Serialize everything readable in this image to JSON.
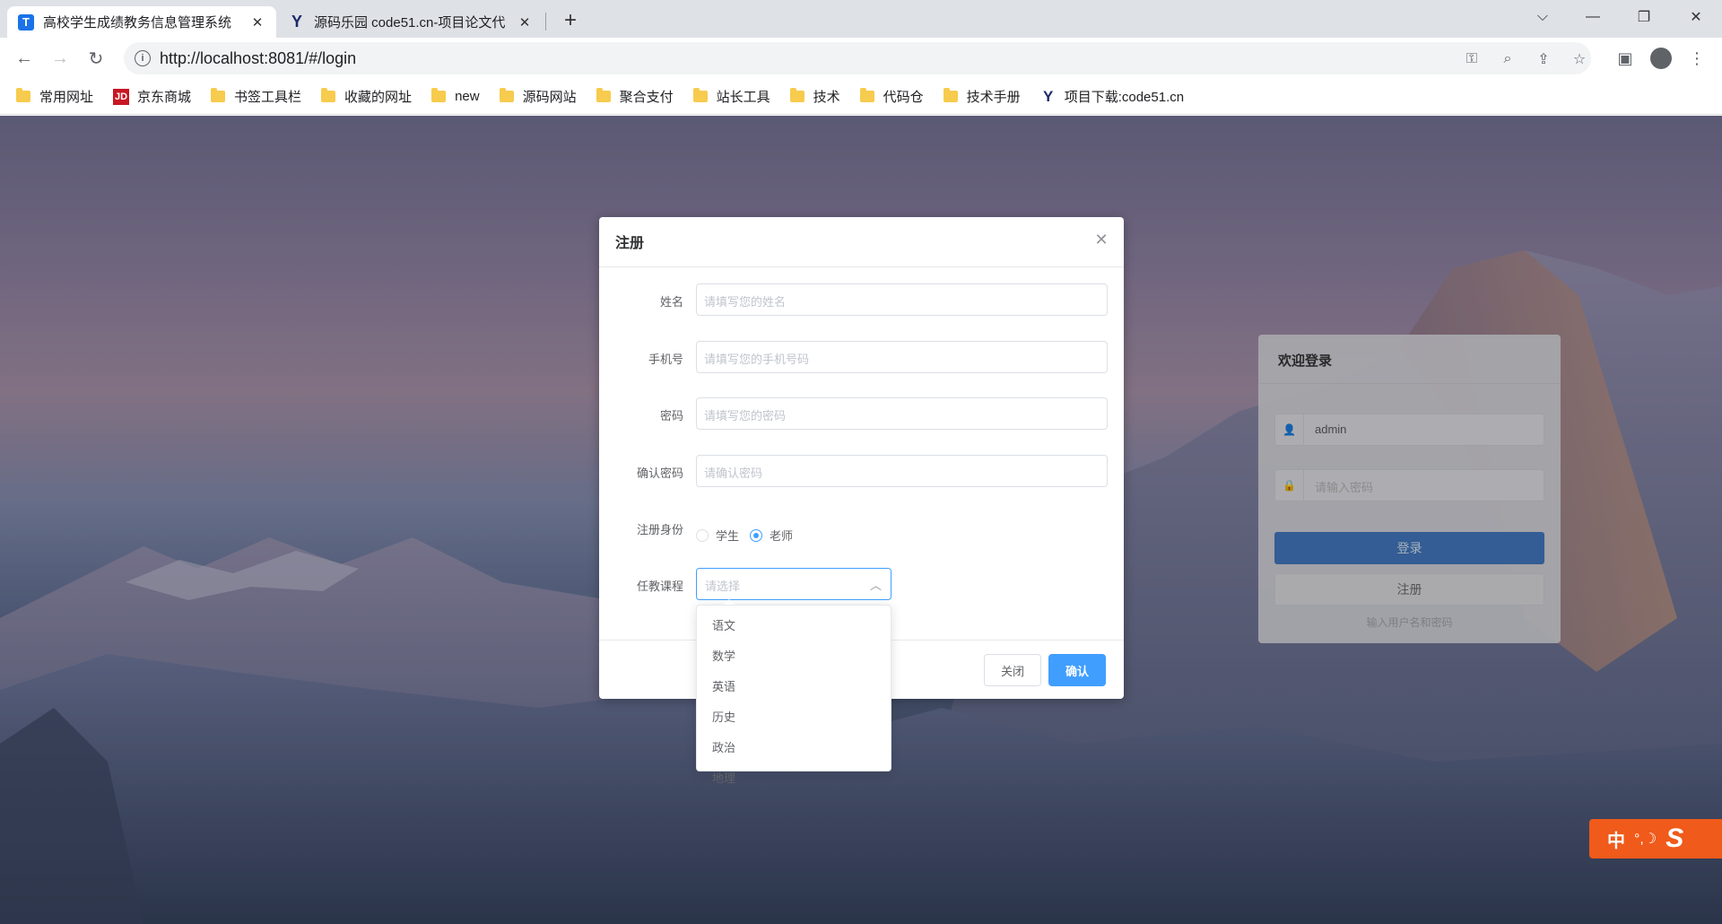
{
  "browser": {
    "tabs": [
      {
        "title": "高校学生成绩教务信息管理系统",
        "favicon": "T"
      },
      {
        "title": "源码乐园 code51.cn-项目论文代",
        "favicon": "Y"
      }
    ],
    "url": "http://localhost:8081/#/login",
    "bookmarks": [
      {
        "label": "常用网址",
        "icon": "folder-icon"
      },
      {
        "label": "京东商城",
        "icon": "jd-logo",
        "logo_text": "JD"
      },
      {
        "label": "书签工具栏",
        "icon": "folder-icon"
      },
      {
        "label": "收藏的网址",
        "icon": "folder-icon"
      },
      {
        "label": "new",
        "icon": "folder-icon"
      },
      {
        "label": "源码网站",
        "icon": "folder-icon"
      },
      {
        "label": "聚合支付",
        "icon": "folder-icon"
      },
      {
        "label": "站长工具",
        "icon": "folder-icon"
      },
      {
        "label": "技术",
        "icon": "folder-icon"
      },
      {
        "label": "代码仓",
        "icon": "folder-icon"
      },
      {
        "label": "技术手册",
        "icon": "folder-icon"
      },
      {
        "label": "项目下载:code51.cn",
        "icon": "y-logo",
        "logo_text": "Y"
      }
    ]
  },
  "login": {
    "title": "欢迎登录",
    "username_value": "admin",
    "password_placeholder": "请输入密码",
    "login_label": "登录",
    "register_label": "注册",
    "hint": "输入用户名和密码"
  },
  "dialog": {
    "title": "注册",
    "fields": {
      "name_label": "姓名",
      "name_placeholder": "请填写您的姓名",
      "phone_label": "手机号",
      "phone_placeholder": "请填写您的手机号码",
      "password_label": "密码",
      "password_placeholder": "请填写您的密码",
      "confirm_label": "确认密码",
      "confirm_placeholder": "请确认密码",
      "role_label": "注册身份",
      "role_options": [
        "学生",
        "老师"
      ],
      "role_selected": "老师",
      "course_label": "任教课程",
      "course_placeholder": "请选择"
    },
    "cancel_label": "关闭",
    "confirm_label": "确认"
  },
  "course_options": [
    "语文",
    "数学",
    "英语",
    "历史",
    "政治",
    "地理"
  ],
  "ime": {
    "mode": "中",
    "symbols": "°,☽",
    "logo": "S"
  },
  "colors": {
    "primary": "#409eff",
    "ime": "#f05a1a"
  }
}
